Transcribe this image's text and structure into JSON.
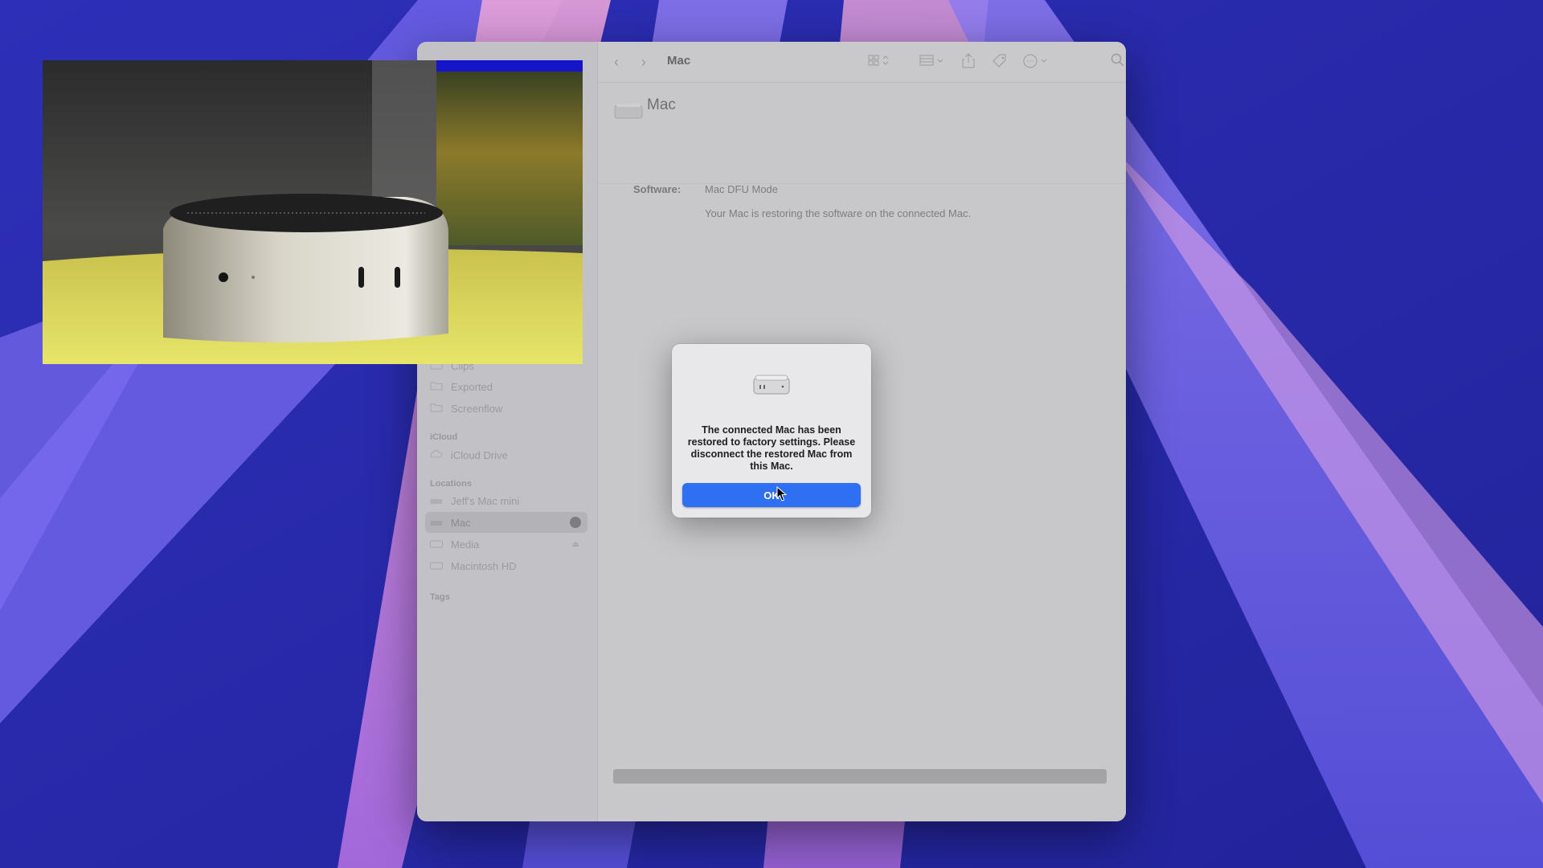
{
  "finder": {
    "toolbar": {
      "title": "Mac",
      "back_icon": "chevron-left-icon",
      "forward_icon": "chevron-right-icon",
      "view_icon": "grid-view-icon",
      "group_icon": "group-icon",
      "share_icon": "share-icon",
      "tag_icon": "tag-icon",
      "more_icon": "ellipsis-circle-icon",
      "search_icon": "search-icon"
    },
    "header": {
      "device_name": "Mac"
    },
    "details": {
      "software_label": "Software:",
      "software_value": "Mac DFU Mode",
      "status_message": "Your Mac is restoring the software on the connected Mac."
    },
    "progress": 1.0,
    "sidebar": {
      "favorites_items": [
        {
          "label": "Clips"
        },
        {
          "label": "Exported"
        },
        {
          "label": "Screenflow"
        }
      ],
      "icloud_section": "iCloud",
      "icloud_items": [
        {
          "label": "iCloud Drive"
        }
      ],
      "locations_section": "Locations",
      "locations_items": [
        {
          "label": "Jeff's Mac mini"
        },
        {
          "label": "Mac"
        },
        {
          "label": "Media"
        },
        {
          "label": "Macintosh HD"
        }
      ],
      "tags_section": "Tags"
    }
  },
  "dialog": {
    "message": "The connected Mac has been restored to factory settings. Please disconnect the restored Mac from this Mac.",
    "ok_label": "OK",
    "icon": "mac-mini-icon"
  },
  "colors": {
    "accent": "#2f6ff2",
    "wallpaper_base": "#2a2ba8"
  }
}
